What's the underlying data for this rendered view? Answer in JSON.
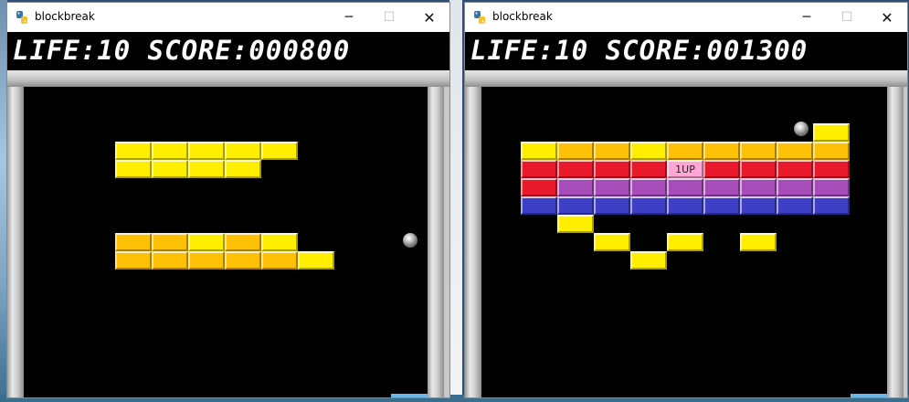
{
  "colors": {
    "yellow": "#ffee00",
    "orange": "#ffc107",
    "red": "#e8192a",
    "purple": "#a64dba",
    "blue": "#3d3fc4",
    "pink": "#ffa6d4",
    "hud_bg": "#000000",
    "hud_text": "#ffffff"
  },
  "windows": [
    {
      "title": "blockbreak",
      "icon": "python-icon",
      "controls": {
        "minimize": "─",
        "maximize": "☐",
        "close": "✕"
      },
      "hud": {
        "life": 10,
        "score": "000800",
        "text": "LIFE:10 SCORE:000800"
      },
      "ball": {
        "color": "gray"
      },
      "bricks": [
        {
          "row": 0,
          "col": 0,
          "color": "yellow"
        },
        {
          "row": 0,
          "col": 1,
          "color": "yellow"
        },
        {
          "row": 0,
          "col": 2,
          "color": "yellow"
        },
        {
          "row": 0,
          "col": 3,
          "color": "yellow"
        },
        {
          "row": 0,
          "col": 4,
          "color": "yellow"
        },
        {
          "row": 1,
          "col": 0,
          "color": "yellow"
        },
        {
          "row": 1,
          "col": 1,
          "color": "yellow"
        },
        {
          "row": 1,
          "col": 2,
          "color": "yellow"
        },
        {
          "row": 1,
          "col": 3,
          "color": "yellow"
        },
        {
          "row": 5,
          "col": 0,
          "color": "orange"
        },
        {
          "row": 5,
          "col": 1,
          "color": "orange"
        },
        {
          "row": 5,
          "col": 2,
          "color": "yellow"
        },
        {
          "row": 5,
          "col": 3,
          "color": "orange"
        },
        {
          "row": 5,
          "col": 4,
          "color": "yellow"
        },
        {
          "row": 6,
          "col": 0,
          "color": "orange"
        },
        {
          "row": 6,
          "col": 1,
          "color": "orange"
        },
        {
          "row": 6,
          "col": 2,
          "color": "orange"
        },
        {
          "row": 6,
          "col": 3,
          "color": "orange"
        },
        {
          "row": 6,
          "col": 4,
          "color": "orange"
        },
        {
          "row": 6,
          "col": 5,
          "color": "yellow"
        }
      ]
    },
    {
      "title": "blockbreak",
      "icon": "python-icon",
      "controls": {
        "minimize": "─",
        "maximize": "☐",
        "close": "✕"
      },
      "hud": {
        "life": 10,
        "score": "001300",
        "text": "LIFE:10 SCORE:001300"
      },
      "ball": {
        "color": "gray"
      },
      "bricks": [
        {
          "row": 0,
          "col": 8,
          "color": "yellow"
        },
        {
          "row": 1,
          "col": 0,
          "color": "yellow"
        },
        {
          "row": 1,
          "col": 1,
          "color": "orange"
        },
        {
          "row": 1,
          "col": 2,
          "color": "orange"
        },
        {
          "row": 1,
          "col": 3,
          "color": "yellow"
        },
        {
          "row": 1,
          "col": 4,
          "color": "orange"
        },
        {
          "row": 1,
          "col": 5,
          "color": "orange"
        },
        {
          "row": 1,
          "col": 6,
          "color": "orange"
        },
        {
          "row": 1,
          "col": 7,
          "color": "orange"
        },
        {
          "row": 1,
          "col": 8,
          "color": "orange"
        },
        {
          "row": 2,
          "col": 0,
          "color": "red"
        },
        {
          "row": 2,
          "col": 1,
          "color": "red"
        },
        {
          "row": 2,
          "col": 2,
          "color": "red"
        },
        {
          "row": 2,
          "col": 3,
          "color": "red"
        },
        {
          "row": 2,
          "col": 4,
          "color": "pink",
          "label": "1UP"
        },
        {
          "row": 2,
          "col": 5,
          "color": "red"
        },
        {
          "row": 2,
          "col": 6,
          "color": "red"
        },
        {
          "row": 2,
          "col": 7,
          "color": "red"
        },
        {
          "row": 2,
          "col": 8,
          "color": "red"
        },
        {
          "row": 3,
          "col": 0,
          "color": "red"
        },
        {
          "row": 3,
          "col": 1,
          "color": "purple"
        },
        {
          "row": 3,
          "col": 2,
          "color": "purple"
        },
        {
          "row": 3,
          "col": 3,
          "color": "purple"
        },
        {
          "row": 3,
          "col": 4,
          "color": "purple"
        },
        {
          "row": 3,
          "col": 5,
          "color": "purple"
        },
        {
          "row": 3,
          "col": 6,
          "color": "purple"
        },
        {
          "row": 3,
          "col": 7,
          "color": "purple"
        },
        {
          "row": 3,
          "col": 8,
          "color": "purple"
        },
        {
          "row": 4,
          "col": 0,
          "color": "blue"
        },
        {
          "row": 4,
          "col": 1,
          "color": "blue"
        },
        {
          "row": 4,
          "col": 2,
          "color": "blue"
        },
        {
          "row": 4,
          "col": 3,
          "color": "blue"
        },
        {
          "row": 4,
          "col": 4,
          "color": "blue"
        },
        {
          "row": 4,
          "col": 5,
          "color": "blue"
        },
        {
          "row": 4,
          "col": 6,
          "color": "blue"
        },
        {
          "row": 4,
          "col": 7,
          "color": "blue"
        },
        {
          "row": 4,
          "col": 8,
          "color": "blue"
        },
        {
          "row": 5,
          "col": 1,
          "color": "yellow"
        },
        {
          "row": 6,
          "col": 2,
          "color": "yellow"
        },
        {
          "row": 6,
          "col": 4,
          "color": "yellow"
        },
        {
          "row": 6,
          "col": 6,
          "color": "yellow"
        },
        {
          "row": 7,
          "col": 3,
          "color": "yellow"
        }
      ]
    }
  ]
}
